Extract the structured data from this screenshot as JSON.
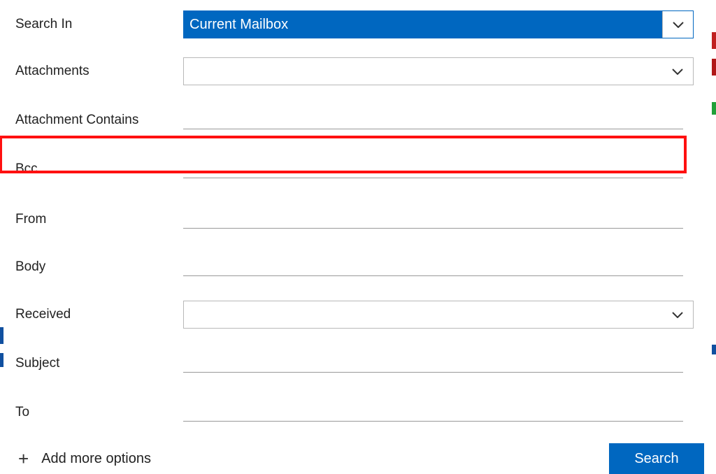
{
  "fields": {
    "search_in": {
      "label": "Search In",
      "value": "Current Mailbox"
    },
    "attachments": {
      "label": "Attachments",
      "value": ""
    },
    "attachment_contains": {
      "label": "Attachment Contains",
      "value": ""
    },
    "bcc": {
      "label": "Bcc",
      "value": ""
    },
    "from": {
      "label": "From",
      "value": ""
    },
    "body": {
      "label": "Body",
      "value": ""
    },
    "received": {
      "label": "Received",
      "value": ""
    },
    "subject": {
      "label": "Subject",
      "value": ""
    },
    "to": {
      "label": "To",
      "value": ""
    }
  },
  "actions": {
    "add_more": "Add more options",
    "search": "Search"
  }
}
